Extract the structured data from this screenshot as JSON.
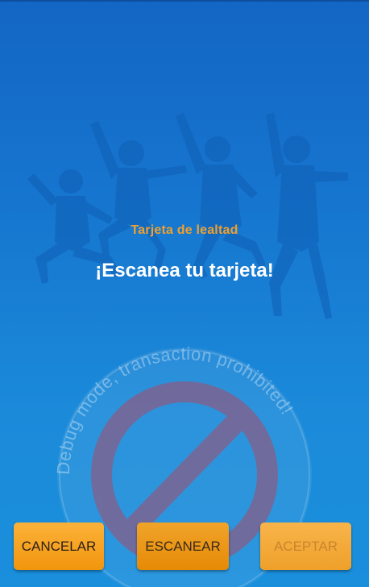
{
  "screen": {
    "subtitle": "Tarjeta de lealtad",
    "title": "¡Escanea tu tarjeta!"
  },
  "watermark": {
    "text": "Debug mode, transaction prohibited!",
    "icon": "prohibited-icon"
  },
  "buttons": {
    "cancel_label": "CANCELAR",
    "scan_label": "ESCANEAR",
    "accept_label": "ACEPTAR"
  },
  "colors": {
    "background_top": "#1466c4",
    "background_bottom": "#1a8fdc",
    "accent_orange": "#f0a02e",
    "button_orange": "#f2950d",
    "watermark_red": "#c0392b"
  }
}
